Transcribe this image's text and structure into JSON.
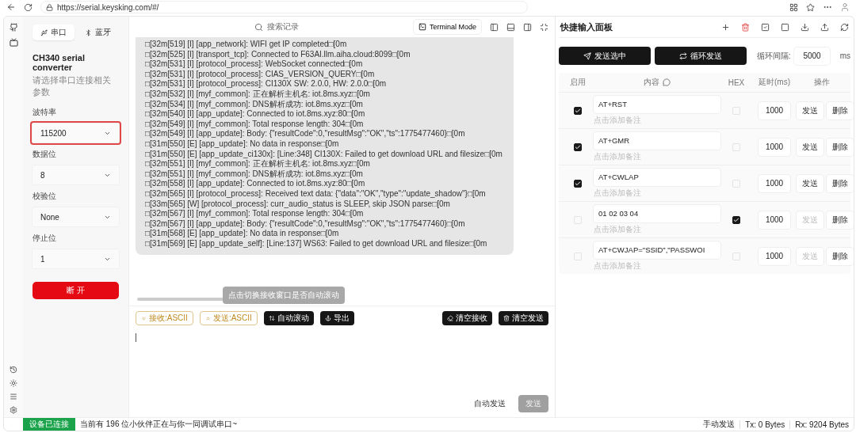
{
  "browser": {
    "url": "https://serial.keysking.com/#/"
  },
  "connection_tabs": [
    {
      "label": "串口",
      "selected": true
    },
    {
      "label": "蓝牙",
      "selected": false
    }
  ],
  "device": {
    "title": "CH340 serial converter",
    "hint": "请选择串口连接相关参数"
  },
  "settings": [
    {
      "label": "波特率",
      "value": "115200",
      "highlighted": true
    },
    {
      "label": "数据位",
      "value": "8",
      "highlighted": false
    },
    {
      "label": "校验位",
      "value": "None",
      "highlighted": false
    },
    {
      "label": "停止位",
      "value": "1",
      "highlighted": false
    }
  ],
  "connect_button": "断 开",
  "toolbar": {
    "search_placeholder": "搜索记录",
    "mode_button": "Terminal Mode"
  },
  "log_lines": [
    "□[32m[519] [I] [app_network]: WIFI get IP completed□[0m",
    "□[32m[525] [I] [transport_tcp]: Connected to F63AI.llm.aiha.cloud:8099□[0m",
    "□[32m[531] [I] [protocol_process]: WebSocket connected□[0m",
    "□[32m[531] [I] [protocol_process]: CIAS_VERSION_QUERY□[0m",
    "□[32m[531] [I] [protocol_process]: CI130X SW: 2.0.0, HW: 2.0.0□[0m",
    "□[32m[532] [I] [myf_common]: 正在解析主机名: iot.8ms.xyz□[0m",
    "□[32m[534] [I] [myf_common]: DNS解析成功: iot.8ms.xyz□[0m",
    "□[32m[540] [I] [app_update]: Connected to iot.8ms.xyz:80□[0m",
    "□[32m[549] [I] [myf_common]: Total response length: 304□[0m",
    "□[32m[549] [I] [app_update]: Body: {\"resultCode\":0,\"resultMsg\":\"OK\",\"ts\":1775477460}□[0m",
    "□[31m[550] [E] [app_update]: No data in response□[0m",
    "□[31m[550] [E] [app_update_ci130x]: [Line:348] CI130X: Failed to get download URL and filesize□[0m",
    "□[32m[551] [I] [myf_common]: 正在解析主机名: iot.8ms.xyz□[0m",
    "□[32m[551] [I] [myf_common]: DNS解析成功: iot.8ms.xyz□[0m",
    "□[32m[558] [I] [app_update]: Connected to iot.8ms.xyz:80□[0m",
    "□[32m[565] [I] [protocol_process]: Received text data: {\"data\":\"OK\",\"type\":\"update_shadow\"}□[0m",
    "□[33m[565] [W] [protocol_process]: curr_audio_status is SLEEP, skip JSON parse□[0m",
    "□[32m[567] [I] [myf_common]: Total response length: 304□[0m",
    "□[32m[567] [I] [app_update]: Body: {\"resultCode\":0,\"resultMsg\":\"OK\",\"ts\":1775477460}□[0m",
    "□[31m[568] [E] [app_update]: No data in response□[0m",
    "□[31m[569] [E] [app_update_self]: [Line:137] WS63: Failed to get download URL and filesize□[0m"
  ],
  "tooltip": "点击切换接收窗口是否自动滚动",
  "format_buttons": [
    "接收:ASCII",
    "发送:ASCII"
  ],
  "action_buttons": [
    {
      "kind": "scroll",
      "label": "自动滚动"
    },
    {
      "kind": "export",
      "label": "导出"
    }
  ],
  "clear_buttons": [
    {
      "kind": "receive",
      "label": "清空接收"
    },
    {
      "kind": "send",
      "label": "清空发送"
    }
  ],
  "auto_send": "自动发送",
  "send_button": "发送",
  "status_bar": {
    "connection": "设备已连接",
    "message": "当前有 196 位小伙伴正在与你一同调试串口~",
    "mode": "手动发送",
    "tx": "Tx: 0 Bytes",
    "rx": "Rx: 9204 Bytes"
  },
  "quick_panel": {
    "title": "快捷输入面板",
    "send_selected": "发送选中",
    "loop_send": "循环发送",
    "interval_label": "循环间隔:",
    "interval": "5000",
    "interval_unit": "ms",
    "columns": [
      "启用",
      "内容",
      "HEX",
      "延时(ms)",
      "操作"
    ],
    "rows": [
      {
        "enabled": true,
        "content": "AT+RST",
        "note": "点击添加备注",
        "hex": false,
        "delay": "1000",
        "send": "发送",
        "delete": "删除"
      },
      {
        "enabled": true,
        "content": "AT+GMR",
        "note": "点击添加备注",
        "hex": false,
        "delay": "1000",
        "send": "发送",
        "delete": "删除"
      },
      {
        "enabled": true,
        "content": "AT+CWLAP",
        "note": "点击添加备注",
        "hex": false,
        "delay": "1000",
        "send": "发送",
        "delete": "删除"
      },
      {
        "enabled": false,
        "content": "01 02 03 04",
        "note": "点击添加备注",
        "hex": true,
        "delay": "1000",
        "send": "发送",
        "delete": "删除"
      },
      {
        "enabled": false,
        "content": "AT+CWJAP=\"SSID\",\"PASSWOI",
        "note": "点击添加备注",
        "hex": false,
        "delay": "1000",
        "send": "发送",
        "delete": "删除"
      }
    ]
  }
}
